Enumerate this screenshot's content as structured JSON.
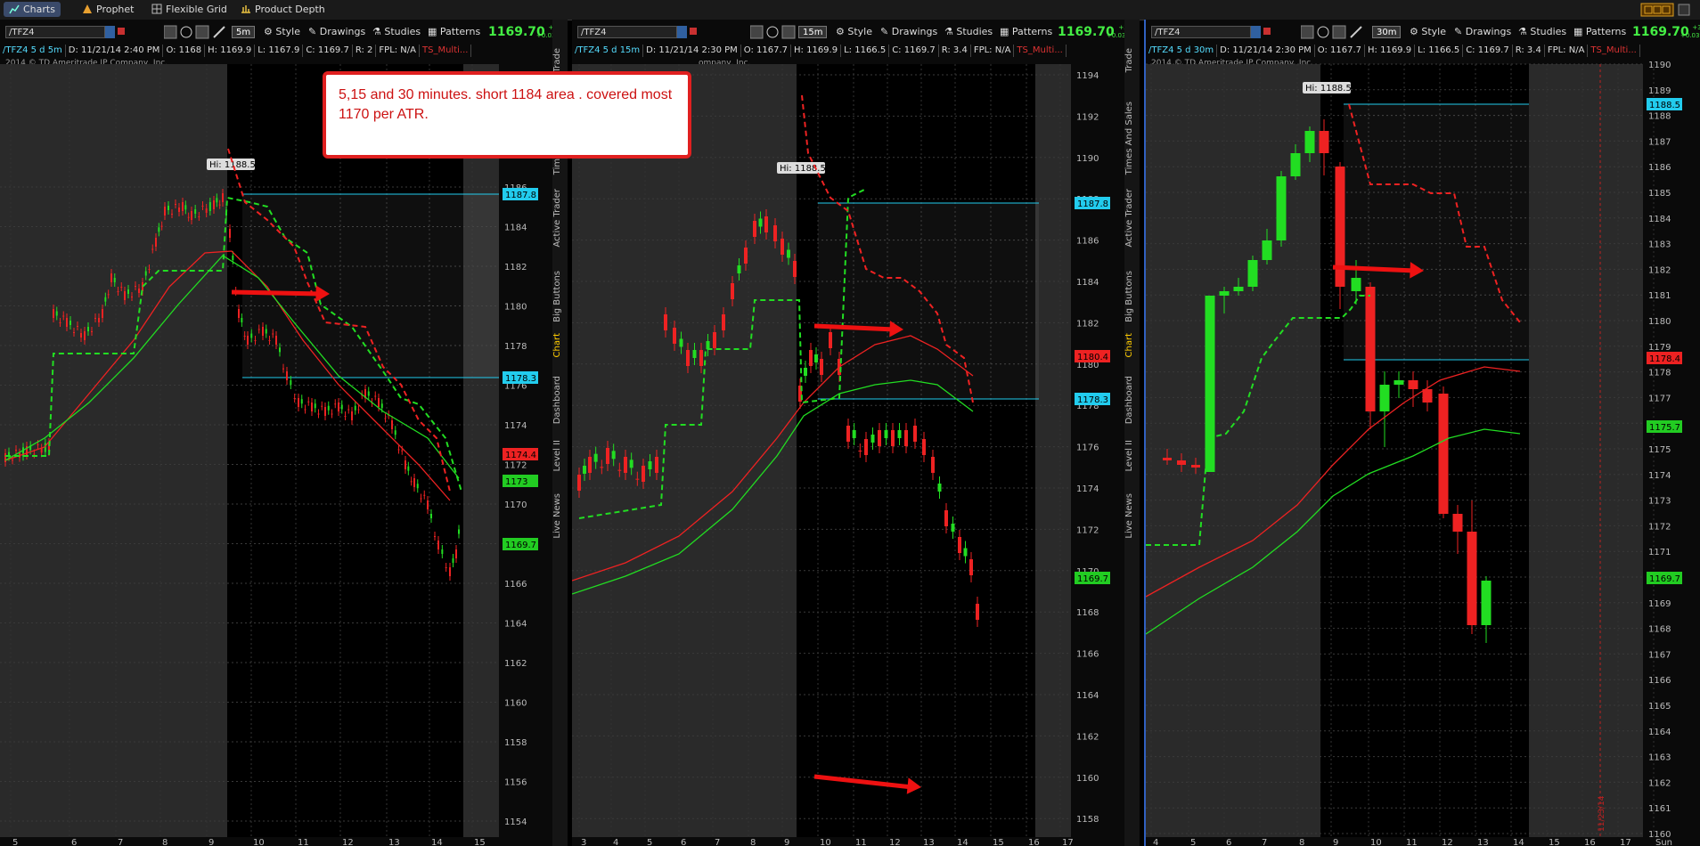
{
  "topbar": {
    "tabs": [
      "Charts",
      "Prophet",
      "Flexible Grid",
      "Product Depth"
    ]
  },
  "toolbar": {
    "style": "Style",
    "drawings": "Drawings",
    "studies": "Studies",
    "patterns": "Patterns"
  },
  "sidetabs": [
    "Trade",
    "Times And Sales",
    "Active Trader",
    "Big Buttons",
    "Chart",
    "Dashboard",
    "Level II",
    "Live News"
  ],
  "note": "5,15 and 30 minutes. short 1184 area . covered most 1170 per ATR.",
  "panels": [
    {
      "symbol": "/TFZ4",
      "timeframe": "5m",
      "last": "1169.70",
      "change": [
        "+30",
        "+0.03%"
      ],
      "info": {
        "sym": "/TFZ4 5 d 5m",
        "d": "D: 11/21/14 2:40 PM",
        "o": "O: 1168",
        "h": "H: 1169.9",
        "l": "L: 1167.9",
        "c": "C: 1169.7",
        "r": "R: 2",
        "fpl": "FPL: N/A",
        "ts": "TS_Multi..."
      },
      "copyright": "2014 © TD Ameritrade IP Company, Inc.",
      "hi_label": "Hi: 1188.5",
      "y_ticks": [
        "1186",
        "1184",
        "1182",
        "1180",
        "1178",
        "1176",
        "1174",
        "1172",
        "1170",
        "1168",
        "1166",
        "1164",
        "1162",
        "1160",
        "1158",
        "1156",
        "1154"
      ],
      "x_ticks": [
        "5",
        "6",
        "7",
        "8",
        "9",
        "10",
        "11",
        "12",
        "13",
        "14",
        "15"
      ],
      "badges": [
        {
          "text": "1187.8",
          "color": "#22ccee"
        },
        {
          "text": "1178.3",
          "color": "#22ccee"
        },
        {
          "text": "1174.4",
          "color": "#ee2222"
        },
        {
          "text": "1173",
          "color": "#22cc22"
        },
        {
          "text": "1169.7",
          "color": "#22cc22"
        }
      ]
    },
    {
      "symbol": "/TFZ4",
      "timeframe": "15m",
      "last": "1169.70",
      "change": [
        "+30",
        "+0.03%"
      ],
      "info": {
        "sym": "/TFZ4 5 d 15m",
        "d": "D: 11/21/14 2:30 PM",
        "o": "O: 1167.7",
        "h": "H: 1169.9",
        "l": "L: 1166.5",
        "c": "C: 1169.7",
        "r": "R: 3.4",
        "fpl": "FPL: N/A",
        "ts": "TS_Multi..."
      },
      "copyright": "ompany, Inc.",
      "hi_label": "Hi: 1188.5",
      "y_ticks": [
        "1194",
        "1192",
        "1190",
        "1188",
        "1186",
        "1184",
        "1182",
        "1180",
        "1178",
        "1176",
        "1174",
        "1172",
        "1170",
        "1168",
        "1166",
        "1164",
        "1162",
        "1160",
        "1158"
      ],
      "x_ticks": [
        "3",
        "4",
        "5",
        "6",
        "7",
        "8",
        "9",
        "10",
        "11",
        "12",
        "13",
        "14",
        "15",
        "16",
        "17"
      ],
      "badges": [
        {
          "text": "1187.8",
          "color": "#22ccee"
        },
        {
          "text": "1180.4",
          "color": "#ee2222"
        },
        {
          "text": "1178.3",
          "color": "#22ccee"
        },
        {
          "text": "1169.7",
          "color": "#22cc22"
        }
      ]
    },
    {
      "symbol": "/TFZ4",
      "timeframe": "30m",
      "last": "1169.70",
      "change": [
        "+30",
        "+0.03%"
      ],
      "info": {
        "sym": "/TFZ4 5 d 30m",
        "d": "D: 11/21/14 2:30 PM",
        "o": "O: 1167.7",
        "h": "H: 1169.9",
        "l": "L: 1166.5",
        "c": "C: 1169.7",
        "r": "R: 3.4",
        "fpl": "FPL: N/A",
        "ts": "TS_Multi..."
      },
      "copyright": "2014 © TD Ameritrade IP Company, Inc.",
      "hi_label": "Hi: 1188.5",
      "y_ticks": [
        "1190",
        "1189",
        "1188",
        "1187",
        "1186",
        "1185",
        "1184",
        "1183",
        "1182",
        "1181",
        "1180",
        "1179",
        "1178",
        "1177",
        "1176",
        "1175",
        "1174",
        "1173",
        "1172",
        "1171",
        "1170",
        "1169",
        "1168",
        "1167",
        "1166",
        "1165",
        "1164",
        "1163",
        "1162",
        "1161",
        "1160"
      ],
      "x_ticks": [
        "4",
        "5",
        "6",
        "7",
        "8",
        "9",
        "10",
        "11",
        "12",
        "13",
        "14",
        "15",
        "16",
        "17",
        "Sun"
      ],
      "badges": [
        {
          "text": "1188.5",
          "color": "#22ccee"
        },
        {
          "text": "1178.4",
          "color": "#ee2222"
        },
        {
          "text": "1175.7",
          "color": "#22cc22"
        },
        {
          "text": "1169.7",
          "color": "#22cc22"
        }
      ],
      "date_mark": "11/23/14"
    }
  ],
  "colors": {
    "up": "#22dd22",
    "down": "#ee2222",
    "cyan": "#22ccee",
    "price": "#44ee44"
  }
}
